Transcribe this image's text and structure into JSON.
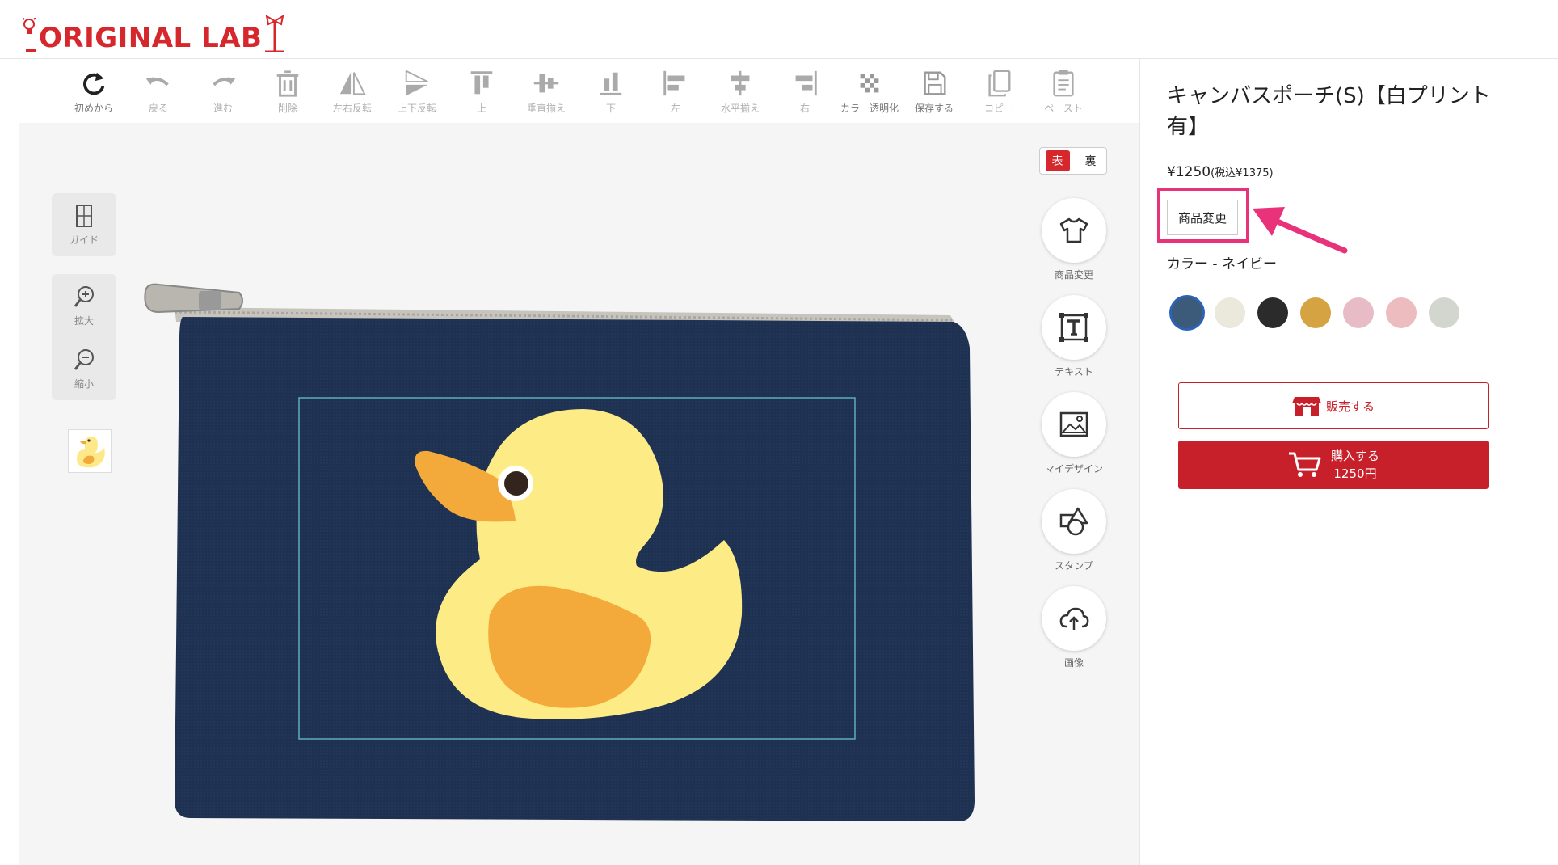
{
  "brand": {
    "logo_text": "ORIGINAL LAB"
  },
  "toolbar": [
    {
      "id": "reset",
      "label": "初めから",
      "icon": "reset-icon"
    },
    {
      "id": "undo",
      "label": "戻る",
      "icon": "undo-icon"
    },
    {
      "id": "redo",
      "label": "進む",
      "icon": "redo-icon"
    },
    {
      "id": "delete",
      "label": "削除",
      "icon": "trash-icon"
    },
    {
      "id": "flip-h",
      "label": "左右反転",
      "icon": "flip-horizontal-icon"
    },
    {
      "id": "flip-v",
      "label": "上下反転",
      "icon": "flip-vertical-icon"
    },
    {
      "id": "align-top",
      "label": "上",
      "icon": "align-top-icon"
    },
    {
      "id": "align-vcenter",
      "label": "垂直揃え",
      "icon": "align-vertical-center-icon"
    },
    {
      "id": "align-bottom",
      "label": "下",
      "icon": "align-bottom-icon"
    },
    {
      "id": "align-left",
      "label": "左",
      "icon": "align-left-icon"
    },
    {
      "id": "align-hcenter",
      "label": "水平揃え",
      "icon": "align-horizontal-center-icon"
    },
    {
      "id": "align-right",
      "label": "右",
      "icon": "align-right-icon"
    },
    {
      "id": "color-transparent",
      "label": "カラー透明化",
      "icon": "checker-icon"
    },
    {
      "id": "save",
      "label": "保存する",
      "icon": "save-icon"
    },
    {
      "id": "copy",
      "label": "コピー",
      "icon": "copy-icon"
    },
    {
      "id": "paste",
      "label": "ペースト",
      "icon": "paste-icon"
    }
  ],
  "left_side": {
    "guide": "ガイド",
    "zoom_in": "拡大",
    "zoom_out": "縮小"
  },
  "face_toggle": {
    "front": "表",
    "back": "裏"
  },
  "right_tools": [
    {
      "id": "change-product",
      "label": "商品変更",
      "icon": "tshirt-icon"
    },
    {
      "id": "text",
      "label": "テキスト",
      "icon": "text-box-icon"
    },
    {
      "id": "my-design",
      "label": "マイデザイン",
      "icon": "image-frame-icon"
    },
    {
      "id": "stamp",
      "label": "スタンプ",
      "icon": "shapes-icon"
    },
    {
      "id": "image",
      "label": "画像",
      "icon": "cloud-upload-icon"
    }
  ],
  "product": {
    "title": "キャンバスポーチ(S)【白プリント有】",
    "price": "¥1250",
    "price_tax": "(税込¥1375)",
    "change_button": "商品変更",
    "color_label": "カラー - ネイビー",
    "colors": [
      "#3c5a7a",
      "#ebe8dc",
      "#2b2b2b",
      "#d5a341",
      "#e8bcc6",
      "#ecbcbf",
      "#d3d6cf"
    ],
    "selected_color": 0
  },
  "actions": {
    "sell": "販売する",
    "buy": "購入する",
    "buy_price": "1250円"
  },
  "colors": {
    "accent_red": "#c8202a",
    "highlight_pink": "#e8327a",
    "pouch_navy": "#1e3150"
  }
}
